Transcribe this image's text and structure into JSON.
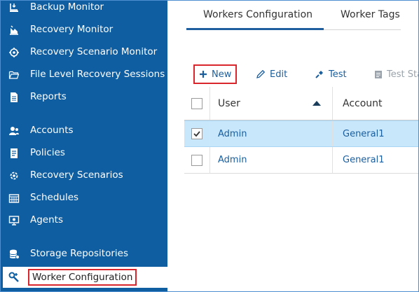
{
  "sidebar": {
    "items": [
      {
        "label": "Backup Monitor",
        "icon": "backup-monitor-icon"
      },
      {
        "label": "Recovery Monitor",
        "icon": "recovery-monitor-icon"
      },
      {
        "label": "Recovery Scenario Monitor",
        "icon": "recovery-scenario-monitor-icon"
      },
      {
        "label": "File Level Recovery Sessions",
        "icon": "folder-icon"
      },
      {
        "label": "Reports",
        "icon": "report-icon"
      },
      {
        "label": "Accounts",
        "icon": "accounts-icon"
      },
      {
        "label": "Policies",
        "icon": "policies-icon"
      },
      {
        "label": "Recovery Scenarios",
        "icon": "recovery-scenarios-icon"
      },
      {
        "label": "Schedules",
        "icon": "calendar-icon"
      },
      {
        "label": "Agents",
        "icon": "agents-icon"
      },
      {
        "label": "Storage Repositories",
        "icon": "storage-icon"
      },
      {
        "label": "Worker Configuration",
        "icon": "worker-configuration-icon",
        "active": true
      }
    ]
  },
  "tabs": [
    {
      "label": "Workers Configuration",
      "active": true
    },
    {
      "label": "Worker Tags",
      "active": false
    }
  ],
  "toolbar": {
    "new_label": "New",
    "edit_label": "Edit",
    "test_label": "Test",
    "test_state_label": "Test Sta"
  },
  "table": {
    "columns": [
      "User",
      "Account"
    ],
    "sort": {
      "column": "User",
      "direction": "ascending"
    },
    "rows": [
      {
        "user": "Admin",
        "account": "General1",
        "checked": true
      },
      {
        "user": "Admin",
        "account": "General1",
        "checked": false
      }
    ]
  },
  "colors": {
    "sidebar_bg": "#0f5ea1",
    "accent": "#1a5e9e",
    "highlight_border": "#d9262c",
    "selected_row": "#c8e7fb"
  }
}
